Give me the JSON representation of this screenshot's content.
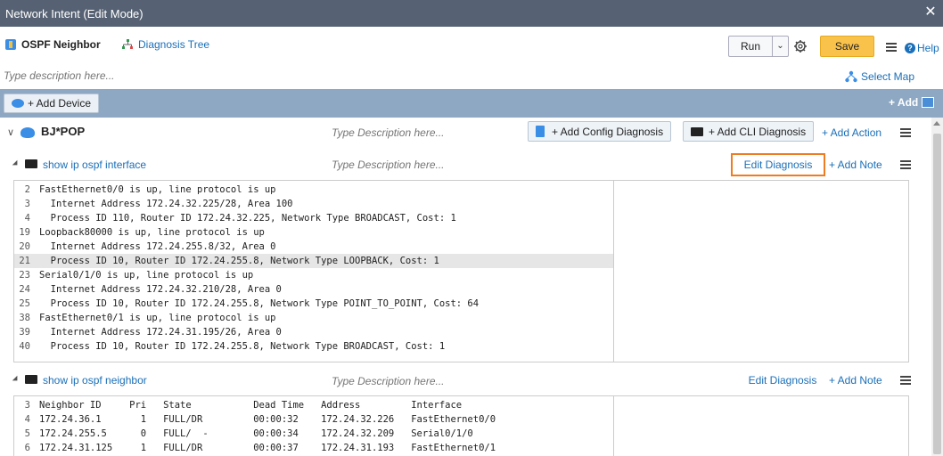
{
  "window": {
    "title": "Network Intent (Edit Mode)"
  },
  "toolbar": {
    "intent_name": "OSPF Neighbor",
    "diagnosis_tree": "Diagnosis Tree",
    "run": "Run",
    "run_dropdown": "⌄",
    "save": "Save",
    "help": "Help"
  },
  "description": {
    "placeholder": "Type description here..."
  },
  "select_map": "Select Map",
  "device_bar": {
    "add_device": "+ Add Device",
    "add": "+ Add"
  },
  "device": {
    "name": "BJ*POP",
    "desc_placeholder": "Type Description here...",
    "add_config_diagnosis": "+ Add Config Diagnosis",
    "add_cli_diagnosis": "+ Add CLI Diagnosis",
    "add_action": "+ Add Action"
  },
  "sections": [
    {
      "command": "show ip ospf interface",
      "desc_placeholder": "Type Description here...",
      "edit_diagnosis": "Edit Diagnosis",
      "add_note": "+ Add Note",
      "lines": [
        {
          "n": "2",
          "text": "FastEthernet0/0 is up, line protocol is up"
        },
        {
          "n": "3",
          "text": "  Internet Address 172.24.32.225/28, Area 100"
        },
        {
          "n": "4",
          "text": "  Process ID 110, Router ID 172.24.32.225, Network Type BROADCAST, Cost: 1"
        },
        {
          "n": "19",
          "text": "Loopback80000 is up, line protocol is up"
        },
        {
          "n": "20",
          "text": "  Internet Address 172.24.255.8/32, Area 0"
        },
        {
          "n": "21",
          "text": "  Process ID 10, Router ID 172.24.255.8, Network Type LOOPBACK, Cost: 1"
        },
        {
          "n": "23",
          "text": "Serial0/1/0 is up, line protocol is up"
        },
        {
          "n": "24",
          "text": "  Internet Address 172.24.32.210/28, Area 0"
        },
        {
          "n": "25",
          "text": "  Process ID 10, Router ID 172.24.255.8, Network Type POINT_TO_POINT, Cost: 64"
        },
        {
          "n": "38",
          "text": "FastEthernet0/1 is up, line protocol is up"
        },
        {
          "n": "39",
          "text": "  Internet Address 172.24.31.195/26, Area 0"
        },
        {
          "n": "40",
          "text": "  Process ID 10, Router ID 172.24.255.8, Network Type BROADCAST, Cost: 1"
        }
      ]
    },
    {
      "command": "show ip ospf neighbor",
      "desc_placeholder": "Type Description here...",
      "edit_diagnosis": "Edit Diagnosis",
      "add_note": "+ Add Note",
      "lines": [
        {
          "n": "3",
          "text": "Neighbor ID     Pri   State           Dead Time   Address         Interface"
        },
        {
          "n": "4",
          "text": "172.24.36.1       1   FULL/DR         00:00:32    172.24.32.226   FastEthernet0/0"
        },
        {
          "n": "5",
          "text": "172.24.255.5      0   FULL/  -        00:00:34    172.24.32.209   Serial0/1/0"
        },
        {
          "n": "6",
          "text": "172.24.31.125     1   FULL/DR         00:00:37    172.24.31.193   FastEthernet0/1"
        }
      ]
    }
  ]
}
